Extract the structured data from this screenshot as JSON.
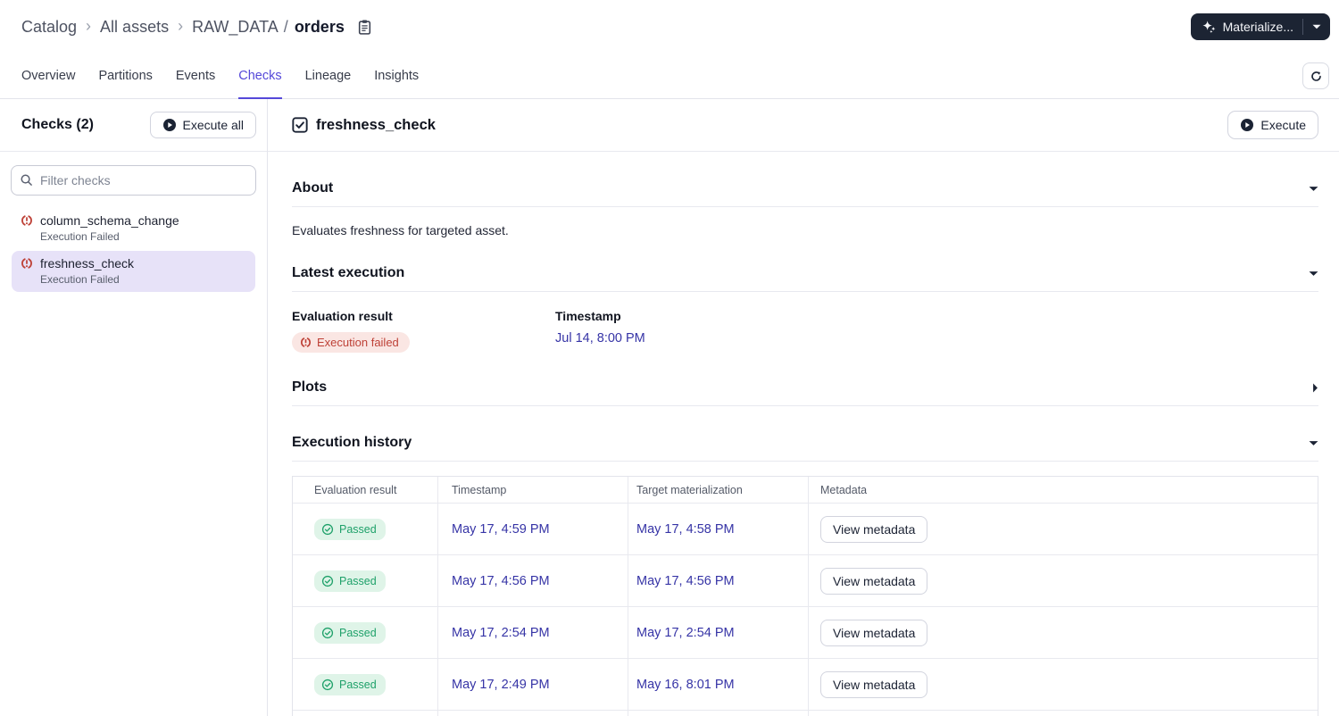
{
  "breadcrumb": {
    "items": [
      {
        "label": "Catalog"
      },
      {
        "label": "All assets"
      }
    ],
    "group": "RAW_DATA",
    "slash": "/",
    "asset": "orders"
  },
  "toolbar": {
    "materialize_label": "Materialize..."
  },
  "tabs": {
    "items": [
      {
        "label": "Overview"
      },
      {
        "label": "Partitions"
      },
      {
        "label": "Events"
      },
      {
        "label": "Checks"
      },
      {
        "label": "Lineage"
      },
      {
        "label": "Insights"
      }
    ],
    "active": "Checks"
  },
  "sidebar": {
    "title": "Checks (2)",
    "execute_all_label": "Execute all",
    "filter_placeholder": "Filter checks",
    "items": [
      {
        "name": "column_schema_change",
        "status": "Execution Failed"
      },
      {
        "name": "freshness_check",
        "status": "Execution Failed"
      }
    ]
  },
  "main": {
    "title": "freshness_check",
    "execute_label": "Execute",
    "sections": {
      "about": {
        "title": "About",
        "description": "Evaluates freshness for targeted asset."
      },
      "latest_execution": {
        "title": "Latest execution",
        "evaluation_label": "Evaluation result",
        "evaluation_badge": "Execution failed",
        "timestamp_label": "Timestamp",
        "timestamp_value": "Jul 14, 8:00 PM"
      },
      "plots": {
        "title": "Plots"
      },
      "execution_history": {
        "title": "Execution history",
        "columns": [
          "Evaluation result",
          "Timestamp",
          "Target materialization",
          "Metadata"
        ],
        "rows": [
          {
            "result": "Passed",
            "timestamp": "May 17, 4:59 PM",
            "target_materialization": "May 17, 4:58 PM",
            "metadata_label": "View metadata"
          },
          {
            "result": "Passed",
            "timestamp": "May 17, 4:56 PM",
            "target_materialization": "May 17, 4:56 PM",
            "metadata_label": "View metadata"
          },
          {
            "result": "Passed",
            "timestamp": "May 17, 2:54 PM",
            "target_materialization": "May 17, 2:54 PM",
            "metadata_label": "View metadata"
          },
          {
            "result": "Passed",
            "timestamp": "May 17, 2:49 PM",
            "target_materialization": "May 16, 8:01 PM",
            "metadata_label": "View metadata"
          }
        ]
      }
    }
  },
  "colors": {
    "accent": "#5548D9",
    "link": "#3634A6",
    "success_text": "#1FA16A",
    "success_bg": "#DFF4E8",
    "danger_text": "#BE4137",
    "danger_bg": "#FAE6E3",
    "selected_bg": "#E7E2F8",
    "dark_button_bg": "#1C2433"
  }
}
